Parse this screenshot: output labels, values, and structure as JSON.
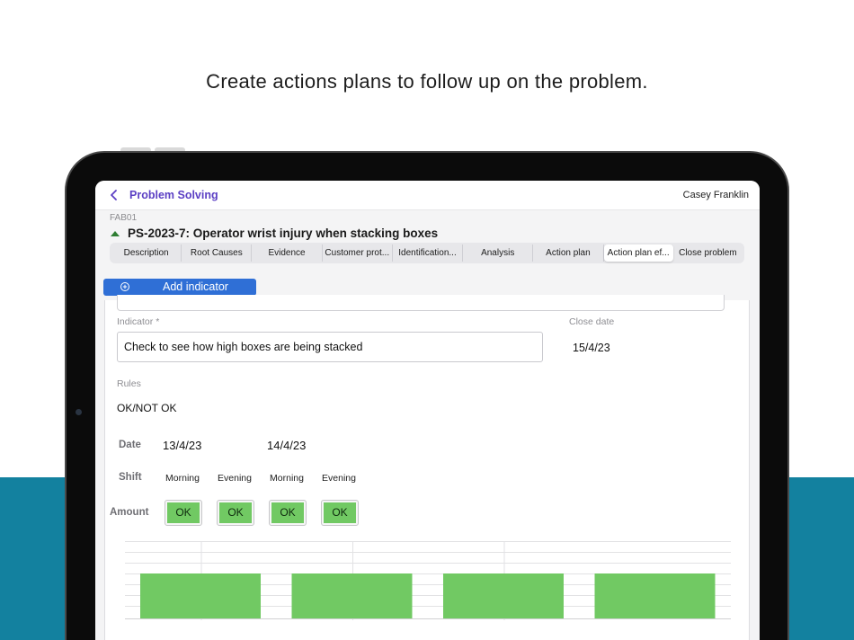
{
  "headline": "Create actions plans to follow up on the problem.",
  "app": {
    "title": "Problem Solving",
    "user": "Casey Franklin"
  },
  "problem": {
    "plant": "FAB01",
    "title": "PS-2023-7: Operator wrist injury when stacking boxes"
  },
  "tabs": [
    {
      "label": "Description",
      "active": false
    },
    {
      "label": "Root Causes",
      "active": false
    },
    {
      "label": "Evidence",
      "active": false
    },
    {
      "label": "Customer prot...",
      "active": false
    },
    {
      "label": "Identification...",
      "active": false
    },
    {
      "label": "Analysis",
      "active": false
    },
    {
      "label": "Action plan",
      "active": false
    },
    {
      "label": "Action plan ef...",
      "active": true
    },
    {
      "label": "Close problem",
      "active": false
    }
  ],
  "add_indicator_label": "Add indicator",
  "indicator": {
    "label": "Indicator *",
    "value": "Check to see how high boxes are being stacked",
    "close_date_label": "Close date",
    "close_date": "15/4/23",
    "rules_label": "Rules",
    "rules_value": "OK/NOT OK"
  },
  "grid": {
    "date_label": "Date",
    "shift_label": "Shift",
    "amount_label": "Amount",
    "dates": [
      "13/4/23",
      "14/4/23"
    ],
    "shifts": [
      "Morning",
      "Evening",
      "Morning",
      "Evening"
    ],
    "amounts": [
      "OK",
      "OK",
      "OK",
      "OK"
    ]
  },
  "colors": {
    "accent": "#5b3fc4",
    "button": "#2f6fd6",
    "ok_green": "#71c963",
    "teal_band": "#13819f"
  },
  "chart_data": {
    "type": "bar",
    "categories": [
      "Morning",
      "Evening",
      "Morning",
      "Evening"
    ],
    "values": [
      1,
      1,
      1,
      1
    ],
    "ylim": [
      0,
      2
    ],
    "grid": true
  }
}
